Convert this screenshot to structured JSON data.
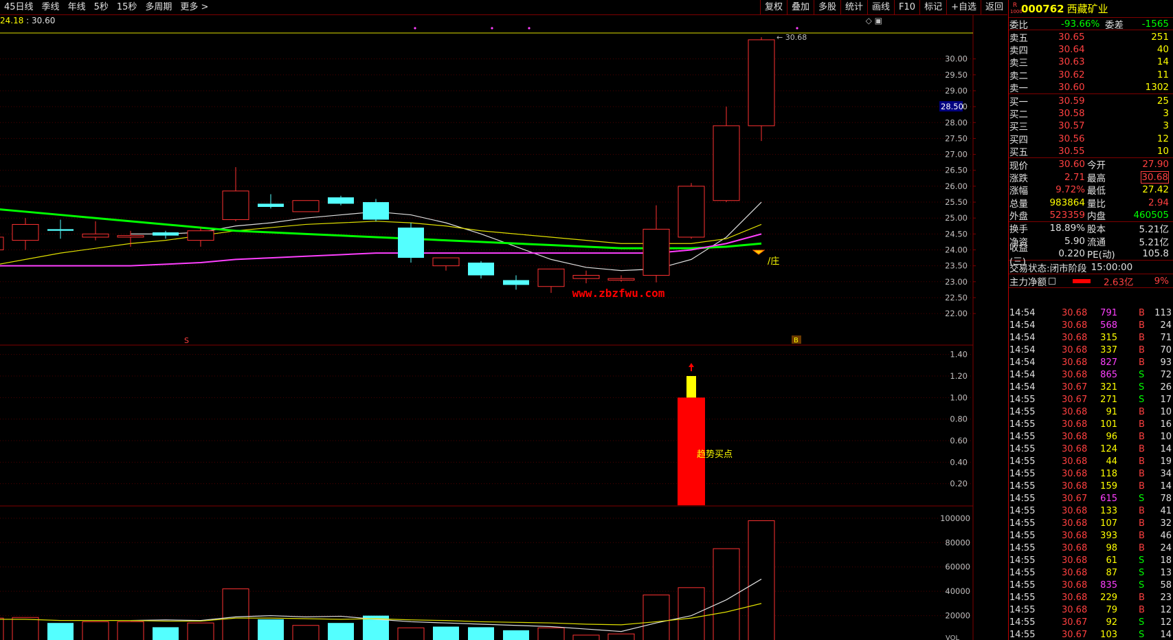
{
  "toolbar": {
    "left_items": [
      "45日线",
      "季线",
      "年线",
      "5秒",
      "15秒",
      "多周期",
      "更多 >"
    ],
    "right_items": [
      "复权",
      "叠加",
      "多股",
      "统计",
      "画线",
      "F10",
      "标记",
      "+自选",
      "返回"
    ]
  },
  "pricebar": {
    "left_value": "24.18",
    "separator": " : ",
    "right_value": "30.60",
    "controls": "◇ ▣"
  },
  "stock": {
    "badge_top": "R",
    "badge_bottom": "1000",
    "code": "000762",
    "name": "西藏矿业"
  },
  "order_book": {
    "weibi_label": "委比",
    "weibi": "-93.66%",
    "weicha_label": "委差",
    "weicha": "-1565",
    "asks": [
      {
        "label": "卖五",
        "price": "30.65",
        "vol": "251"
      },
      {
        "label": "卖四",
        "price": "30.64",
        "vol": "40"
      },
      {
        "label": "卖三",
        "price": "30.63",
        "vol": "14"
      },
      {
        "label": "卖二",
        "price": "30.62",
        "vol": "11"
      },
      {
        "label": "卖一",
        "price": "30.60",
        "vol": "1302"
      }
    ],
    "bids": [
      {
        "label": "买一",
        "price": "30.59",
        "vol": "25"
      },
      {
        "label": "买二",
        "price": "30.58",
        "vol": "3"
      },
      {
        "label": "买三",
        "price": "30.57",
        "vol": "3"
      },
      {
        "label": "买四",
        "price": "30.56",
        "vol": "12"
      },
      {
        "label": "买五",
        "price": "30.55",
        "vol": "10"
      }
    ]
  },
  "quote": [
    {
      "l1": "现价",
      "v1": "30.60",
      "c1": "red",
      "l2": "今开",
      "v2": "27.90",
      "c2": "red"
    },
    {
      "l1": "涨跌",
      "v1": "2.71",
      "c1": "red",
      "l2": "最高",
      "v2": "30.68",
      "c2": "red"
    },
    {
      "l1": "涨幅",
      "v1": "9.72%",
      "c1": "red",
      "l2": "最低",
      "v2": "27.42",
      "c2": "yellow"
    },
    {
      "l1": "总量",
      "v1": "983864",
      "c1": "yellow",
      "l2": "量比",
      "v2": "2.94",
      "c2": "red"
    },
    {
      "l1": "外盘",
      "v1": "523359",
      "c1": "red",
      "l2": "内盘",
      "v2": "460505",
      "c2": "green"
    }
  ],
  "finance": [
    {
      "l1": "换手",
      "v1": "18.89%",
      "l2": "股本",
      "v2": "5.21亿"
    },
    {
      "l1": "净资",
      "v1": "5.90",
      "l2": "流通",
      "v2": "5.21亿"
    },
    {
      "l1": "收益(三)",
      "v1": "0.220",
      "l2": "PE(动)",
      "v2": "105.8"
    }
  ],
  "trade_status": {
    "label": "交易状态:",
    "value": "闭市阶段",
    "time": "15:00:00"
  },
  "main_force": {
    "label": "主力净额",
    "amount": "2.63亿",
    "pct": "9%"
  },
  "ticks": [
    {
      "t": "14:54",
      "p": "30.68",
      "v": "791",
      "vc": "magenta",
      "bs": "B",
      "n": "113"
    },
    {
      "t": "14:54",
      "p": "30.68",
      "v": "568",
      "vc": "magenta",
      "bs": "B",
      "n": "24"
    },
    {
      "t": "14:54",
      "p": "30.68",
      "v": "315",
      "vc": "yellow",
      "bs": "B",
      "n": "71"
    },
    {
      "t": "14:54",
      "p": "30.68",
      "v": "337",
      "vc": "yellow",
      "bs": "B",
      "n": "70"
    },
    {
      "t": "14:54",
      "p": "30.68",
      "v": "827",
      "vc": "magenta",
      "bs": "B",
      "n": "93"
    },
    {
      "t": "14:54",
      "p": "30.68",
      "v": "865",
      "vc": "magenta",
      "bs": "S",
      "n": "72"
    },
    {
      "t": "14:54",
      "p": "30.67",
      "v": "321",
      "vc": "yellow",
      "bs": "S",
      "n": "26"
    },
    {
      "t": "14:55",
      "p": "30.67",
      "v": "271",
      "vc": "yellow",
      "bs": "S",
      "n": "17"
    },
    {
      "t": "14:55",
      "p": "30.68",
      "v": "91",
      "vc": "yellow",
      "bs": "B",
      "n": "10"
    },
    {
      "t": "14:55",
      "p": "30.68",
      "v": "101",
      "vc": "yellow",
      "bs": "B",
      "n": "16"
    },
    {
      "t": "14:55",
      "p": "30.68",
      "v": "96",
      "vc": "yellow",
      "bs": "B",
      "n": "10"
    },
    {
      "t": "14:55",
      "p": "30.68",
      "v": "124",
      "vc": "yellow",
      "bs": "B",
      "n": "14"
    },
    {
      "t": "14:55",
      "p": "30.68",
      "v": "44",
      "vc": "yellow",
      "bs": "B",
      "n": "19"
    },
    {
      "t": "14:55",
      "p": "30.68",
      "v": "118",
      "vc": "yellow",
      "bs": "B",
      "n": "34"
    },
    {
      "t": "14:55",
      "p": "30.68",
      "v": "159",
      "vc": "yellow",
      "bs": "B",
      "n": "14"
    },
    {
      "t": "14:55",
      "p": "30.67",
      "v": "615",
      "vc": "magenta",
      "bs": "S",
      "n": "78"
    },
    {
      "t": "14:55",
      "p": "30.68",
      "v": "133",
      "vc": "yellow",
      "bs": "B",
      "n": "41"
    },
    {
      "t": "14:55",
      "p": "30.68",
      "v": "107",
      "vc": "yellow",
      "bs": "B",
      "n": "32"
    },
    {
      "t": "14:55",
      "p": "30.68",
      "v": "393",
      "vc": "yellow",
      "bs": "B",
      "n": "46"
    },
    {
      "t": "14:55",
      "p": "30.68",
      "v": "98",
      "vc": "yellow",
      "bs": "B",
      "n": "24"
    },
    {
      "t": "14:55",
      "p": "30.68",
      "v": "61",
      "vc": "yellow",
      "bs": "S",
      "n": "18"
    },
    {
      "t": "14:55",
      "p": "30.68",
      "v": "87",
      "vc": "yellow",
      "bs": "S",
      "n": "13"
    },
    {
      "t": "14:55",
      "p": "30.68",
      "v": "835",
      "vc": "magenta",
      "bs": "S",
      "n": "58"
    },
    {
      "t": "14:55",
      "p": "30.68",
      "v": "229",
      "vc": "yellow",
      "bs": "B",
      "n": "23"
    },
    {
      "t": "14:55",
      "p": "30.68",
      "v": "79",
      "vc": "yellow",
      "bs": "B",
      "n": "12"
    },
    {
      "t": "14:55",
      "p": "30.67",
      "v": "92",
      "vc": "yellow",
      "bs": "S",
      "n": "12"
    },
    {
      "t": "14:55",
      "p": "30.67",
      "v": "103",
      "vc": "yellow",
      "bs": "S",
      "n": "14"
    }
  ],
  "chart_data": [
    {
      "type": "candlestick",
      "title": "",
      "y_ticks": [
        "30.00",
        "29.50",
        "29.00",
        "28.50",
        "28.00",
        "27.50",
        "27.00",
        "26.50",
        "26.00",
        "25.50",
        "25.00",
        "24.50",
        "24.00",
        "23.50",
        "23.00",
        "22.50",
        "22.00"
      ],
      "ylim": [
        21.7,
        30.9
      ],
      "current_price_label": "28.50",
      "high_label": "30.68",
      "candles": [
        {
          "o": 24.0,
          "c": 24.4,
          "h": 24.6,
          "l": 23.7,
          "up": true
        },
        {
          "o": 24.3,
          "c": 24.8,
          "h": 25.0,
          "l": 24.0,
          "up": true
        },
        {
          "o": 24.65,
          "c": 24.6,
          "h": 24.95,
          "l": 24.35,
          "up": false
        },
        {
          "o": 24.4,
          "c": 24.5,
          "h": 24.9,
          "l": 24.3,
          "up": true
        },
        {
          "o": 24.4,
          "c": 24.45,
          "h": 24.6,
          "l": 24.1,
          "up": true
        },
        {
          "o": 24.55,
          "c": 24.45,
          "h": 24.6,
          "l": 24.35,
          "up": false
        },
        {
          "o": 24.3,
          "c": 24.6,
          "h": 24.7,
          "l": 24.1,
          "up": true
        },
        {
          "o": 24.95,
          "c": 25.85,
          "h": 26.6,
          "l": 24.9,
          "up": true
        },
        {
          "o": 25.45,
          "c": 25.35,
          "h": 25.75,
          "l": 25.3,
          "up": false
        },
        {
          "o": 25.2,
          "c": 25.55,
          "h": 25.55,
          "l": 25.2,
          "up": true
        },
        {
          "o": 25.65,
          "c": 25.45,
          "h": 25.7,
          "l": 25.4,
          "up": false
        },
        {
          "o": 25.5,
          "c": 24.95,
          "h": 25.6,
          "l": 24.9,
          "up": false
        },
        {
          "o": 24.7,
          "c": 23.75,
          "h": 24.85,
          "l": 23.6,
          "up": false
        },
        {
          "o": 23.5,
          "c": 23.75,
          "h": 23.75,
          "l": 23.35,
          "up": true
        },
        {
          "o": 23.6,
          "c": 23.2,
          "h": 23.65,
          "l": 23.1,
          "up": false
        },
        {
          "o": 23.05,
          "c": 22.9,
          "h": 23.2,
          "l": 22.75,
          "up": false
        },
        {
          "o": 22.85,
          "c": 23.4,
          "h": 23.4,
          "l": 22.65,
          "up": true
        },
        {
          "o": 23.1,
          "c": 23.2,
          "h": 23.35,
          "l": 22.95,
          "up": true
        },
        {
          "o": 23.05,
          "c": 23.1,
          "h": 23.2,
          "l": 23.0,
          "up": true
        },
        {
          "o": 23.2,
          "c": 24.65,
          "h": 25.4,
          "l": 22.98,
          "up": true
        },
        {
          "o": 24.4,
          "c": 26.0,
          "h": 26.1,
          "l": 24.35,
          "up": true
        },
        {
          "o": 25.55,
          "c": 27.9,
          "h": 28.5,
          "l": 25.5,
          "up": true
        },
        {
          "o": 27.9,
          "c": 30.6,
          "h": 30.68,
          "l": 27.42,
          "up": true
        }
      ],
      "ma_lines": [
        {
          "color": "#e0e0e0",
          "values": [
            null,
            null,
            null,
            null,
            24.5,
            24.5,
            24.55,
            24.75,
            24.85,
            25.0,
            25.1,
            25.2,
            25.1,
            24.85,
            24.5,
            24.1,
            23.7,
            23.45,
            23.35,
            23.4,
            23.7,
            24.4,
            25.5
          ]
        },
        {
          "color": "#e0e000",
          "values": [
            23.5,
            23.7,
            23.9,
            24.05,
            24.2,
            24.3,
            24.45,
            24.6,
            24.7,
            24.8,
            24.85,
            24.9,
            24.85,
            24.75,
            24.6,
            24.5,
            24.4,
            24.3,
            24.2,
            24.2,
            24.2,
            24.35,
            24.8
          ]
        },
        {
          "color": "#00ff00",
          "values": [
            25.3,
            25.2,
            25.1,
            25.0,
            24.9,
            24.8,
            24.7,
            24.6,
            24.55,
            24.5,
            24.45,
            24.4,
            24.35,
            24.3,
            24.25,
            24.2,
            24.15,
            24.1,
            24.05,
            24.05,
            24.05,
            24.1,
            24.2
          ]
        },
        {
          "color": "#ff40ff",
          "values": [
            23.5,
            23.5,
            23.5,
            23.5,
            23.5,
            23.55,
            23.6,
            23.7,
            23.75,
            23.8,
            23.85,
            23.9,
            23.9,
            23.9,
            23.9,
            23.9,
            23.9,
            23.9,
            23.9,
            23.9,
            24.0,
            24.2,
            24.5
          ]
        }
      ],
      "annotations": [
        {
          "text": "庄",
          "color": "#ffff00"
        },
        {
          "text": "www.zbzfwu.com",
          "color": "#ff0000"
        },
        {
          "text": "S",
          "color": "#ff4040"
        },
        {
          "text": "B",
          "color": "#ffff00"
        }
      ]
    },
    {
      "type": "bar",
      "title": "",
      "y_ticks": [
        "1.40",
        "1.20",
        "1.00",
        "0.80",
        "0.60",
        "0.40",
        "0.20"
      ],
      "ylim": [
        0,
        1.5
      ],
      "bar": {
        "index": 20,
        "value_red": 1.0,
        "value_yellow_top": 1.2
      },
      "label": "趋势买点"
    },
    {
      "type": "bar",
      "title": "",
      "y_ticks": [
        "100000",
        "80000",
        "60000",
        "40000",
        "20000"
      ],
      "ylim": [
        0,
        105000
      ],
      "tag": "VOL",
      "volumes": [
        {
          "v": 18000,
          "up": true
        },
        {
          "v": 18500,
          "up": true
        },
        {
          "v": 14000,
          "up": false
        },
        {
          "v": 15000,
          "up": true
        },
        {
          "v": 15000,
          "up": true
        },
        {
          "v": 10500,
          "up": false
        },
        {
          "v": 14000,
          "up": true
        },
        {
          "v": 42000,
          "up": true
        },
        {
          "v": 17000,
          "up": false
        },
        {
          "v": 12000,
          "up": true
        },
        {
          "v": 14000,
          "up": false
        },
        {
          "v": 20000,
          "up": false
        },
        {
          "v": 10000,
          "up": true
        },
        {
          "v": 11000,
          "up": false
        },
        {
          "v": 10500,
          "up": false
        },
        {
          "v": 8000,
          "up": false
        },
        {
          "v": 10000,
          "up": true
        },
        {
          "v": 4000,
          "up": true
        },
        {
          "v": 5000,
          "up": true
        },
        {
          "v": 37000,
          "up": true
        },
        {
          "v": 43000,
          "up": true
        },
        {
          "v": 75000,
          "up": true
        },
        {
          "v": 98000,
          "up": true
        }
      ],
      "ma_lines": [
        {
          "color": "#e0e0e0",
          "values": [
            null,
            null,
            null,
            null,
            16000,
            16500,
            16000,
            19000,
            20000,
            19000,
            19500,
            17000,
            15000,
            14000,
            13000,
            12000,
            11000,
            9000,
            7000,
            14000,
            20000,
            33000,
            50000
          ]
        },
        {
          "color": "#e0e000",
          "values": [
            17000,
            17000,
            16000,
            16000,
            16000,
            15500,
            15500,
            18000,
            18000,
            17500,
            17000,
            17500,
            16500,
            16000,
            15000,
            14500,
            14000,
            13000,
            12500,
            15000,
            18000,
            23000,
            30000
          ]
        }
      ]
    }
  ]
}
